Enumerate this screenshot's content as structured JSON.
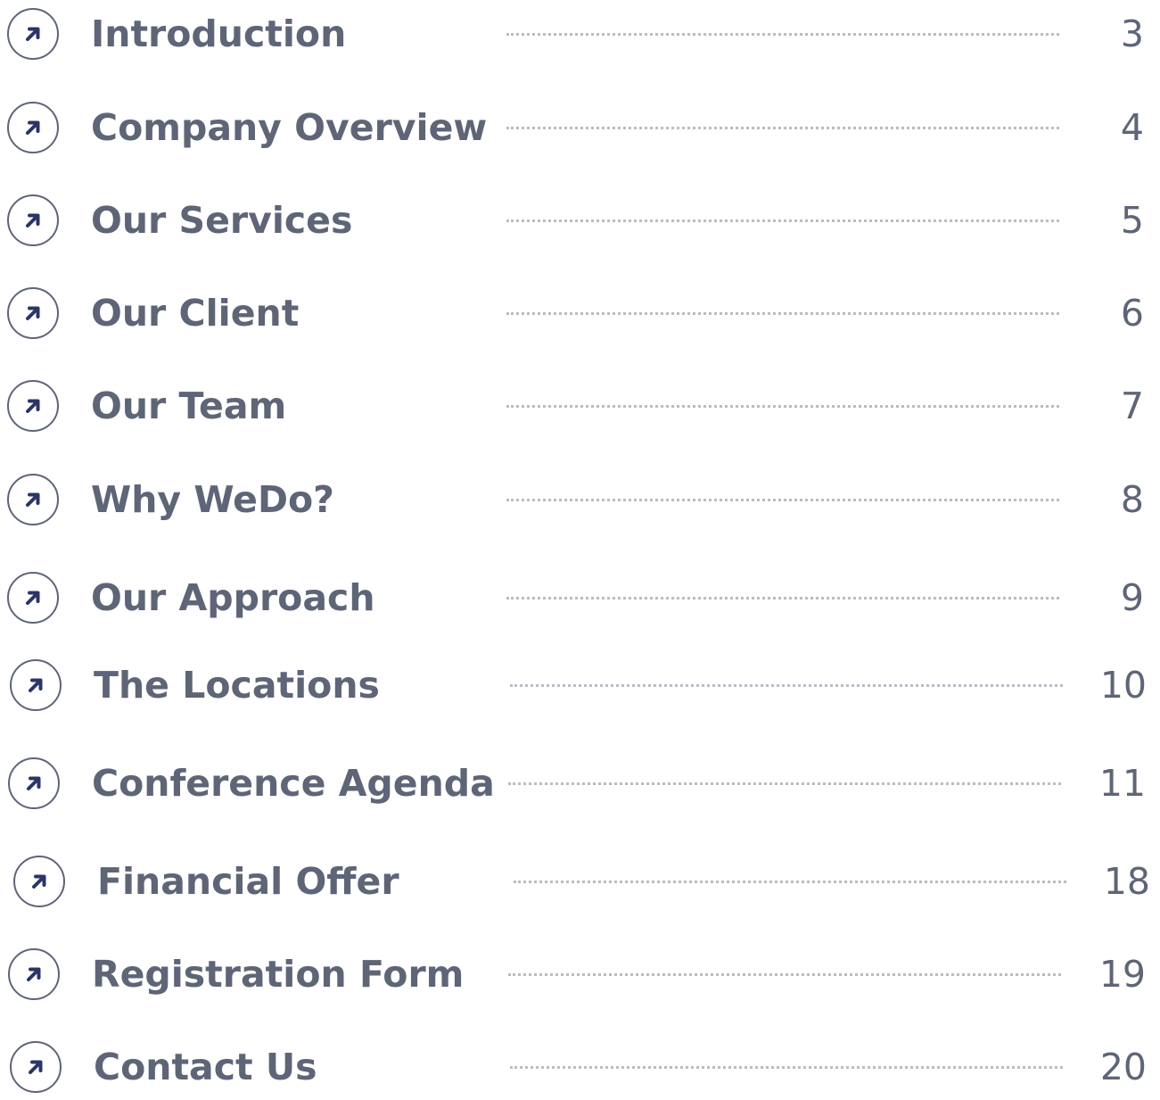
{
  "toc": {
    "items": [
      {
        "title": "Introduction",
        "page": "3",
        "icon": "arrow-up-right-icon"
      },
      {
        "title": "Company Overview",
        "page": "4",
        "icon": "arrow-up-right-icon"
      },
      {
        "title": "Our Services",
        "page": "5",
        "icon": "arrow-up-right-icon"
      },
      {
        "title": "Our Client",
        "page": "6",
        "icon": "arrow-up-right-icon"
      },
      {
        "title": "Our Team",
        "page": "7",
        "icon": "arrow-up-right-icon"
      },
      {
        "title": "Why WeDo?",
        "page": "8",
        "icon": "arrow-up-right-icon"
      },
      {
        "title": "Our Approach",
        "page": "9",
        "icon": "arrow-up-right-icon"
      },
      {
        "title": "The Locations",
        "page": "10",
        "icon": "arrow-up-right-icon"
      },
      {
        "title": "Conference Agenda",
        "page": "11",
        "icon": "arrow-up-right-icon"
      },
      {
        "title": "Financial Offer",
        "page": "18",
        "icon": "arrow-up-right-icon"
      },
      {
        "title": "Registration Form",
        "page": "19",
        "icon": "arrow-up-right-icon"
      },
      {
        "title": "Contact Us",
        "page": "20",
        "icon": "arrow-up-right-icon"
      }
    ]
  },
  "colors": {
    "text": "#5e6577",
    "arrow": "#2b3566",
    "leader": "#b9bcc4"
  }
}
